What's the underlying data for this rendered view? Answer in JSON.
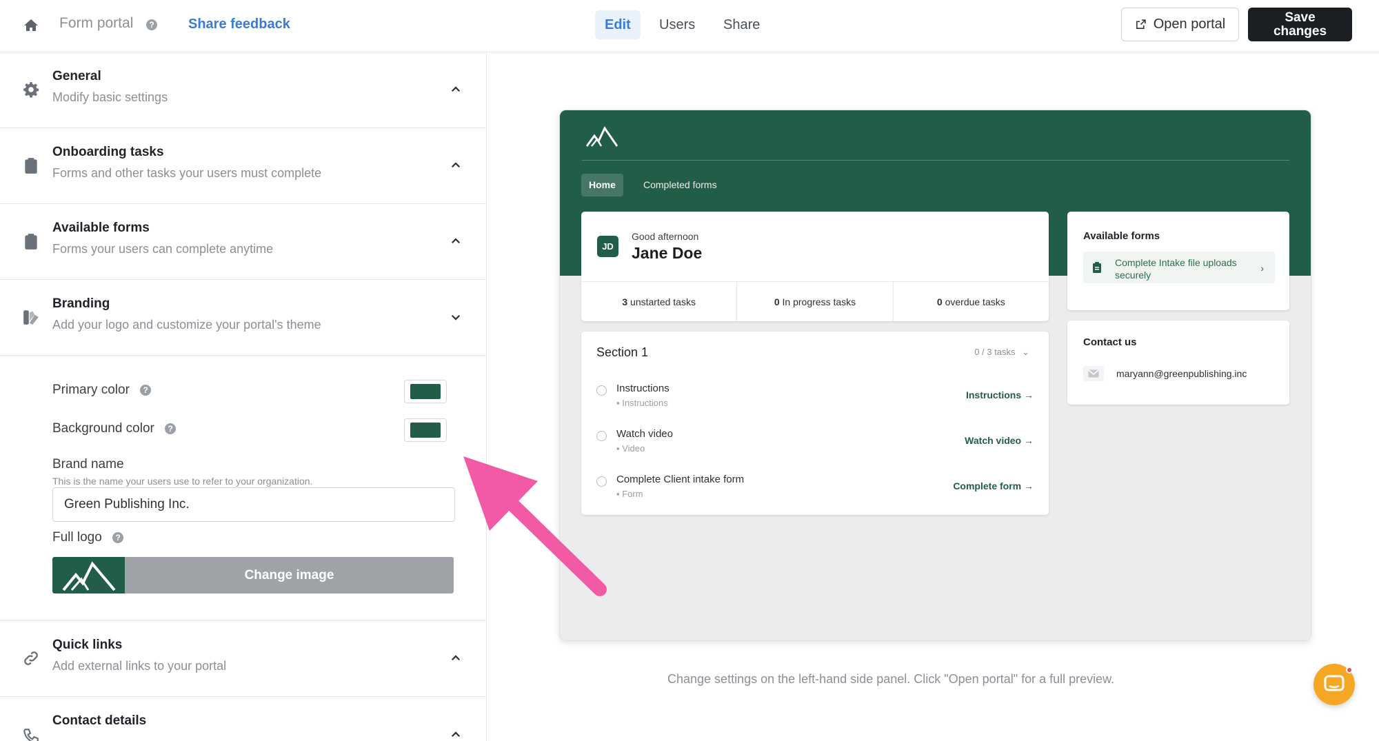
{
  "topbar": {
    "portal_title": "Form portal",
    "share_feedback": "Share feedback",
    "tabs": [
      {
        "label": "Edit",
        "active": true
      },
      {
        "label": "Users",
        "active": false
      },
      {
        "label": "Share",
        "active": false
      }
    ],
    "open_portal_label": "Open portal",
    "save_line1": "Save",
    "save_line2": "changes"
  },
  "sections": [
    {
      "title": "General",
      "subtitle": "Modify basic settings",
      "icon": "gear-icon",
      "expanded": false
    },
    {
      "title": "Onboarding tasks",
      "subtitle": "Forms and other tasks your users must complete",
      "icon": "clipboard-icon",
      "expanded": false
    },
    {
      "title": "Available forms",
      "subtitle": "Forms your users can complete anytime",
      "icon": "clipboard-icon",
      "expanded": false
    },
    {
      "title": "Branding",
      "subtitle": "Add your logo and customize your portal's theme",
      "icon": "palette-icon",
      "expanded": true
    },
    {
      "title": "Quick links",
      "subtitle": "Add external links to your portal",
      "icon": "link-icon",
      "expanded": false
    },
    {
      "title": "Contact details",
      "subtitle": "",
      "icon": "phone-icon",
      "expanded": false
    }
  ],
  "branding": {
    "primary_color_label": "Primary color",
    "primary_color": "#225e47",
    "background_color_label": "Background color",
    "background_color": "#225e47",
    "brand_name_label": "Brand name",
    "brand_name_hint": "This is the name your users use to refer to your organization.",
    "brand_name_value": "Green Publishing Inc.",
    "full_logo_label": "Full logo",
    "change_image_label": "Change image"
  },
  "preview": {
    "tabs": [
      {
        "label": "Home",
        "active": true
      },
      {
        "label": "Completed forms",
        "active": false
      }
    ],
    "avatar_initials": "JD",
    "greeting": "Good afternoon",
    "user_name": "Jane Doe",
    "stats": [
      {
        "count": "3",
        "label": "unstarted tasks"
      },
      {
        "count": "0",
        "label": "In progress tasks"
      },
      {
        "count": "0",
        "label": "overdue tasks"
      }
    ],
    "section_title": "Section 1",
    "section_count": "0 / 3 tasks",
    "tasks": [
      {
        "title": "Instructions",
        "type": "Instructions",
        "action": "Instructions"
      },
      {
        "title": "Watch video",
        "type": "Video",
        "action": "Watch video"
      },
      {
        "title": "Complete Client intake form",
        "type": "Form",
        "action": "Complete form"
      }
    ],
    "available_forms_title": "Available forms",
    "available_form_item": "Complete Intake file uploads securely",
    "contact_title": "Contact us",
    "contact_email": "maryann@greenpublishing.inc"
  },
  "footnote": "Change settings on the left-hand side panel. Click \"Open portal\" for a full preview.",
  "colors": {
    "brand_green": "#225e47",
    "accent_blue": "#3a7bd5",
    "annotation_pink": "#f25aa6",
    "chat_orange": "#f5a623"
  }
}
